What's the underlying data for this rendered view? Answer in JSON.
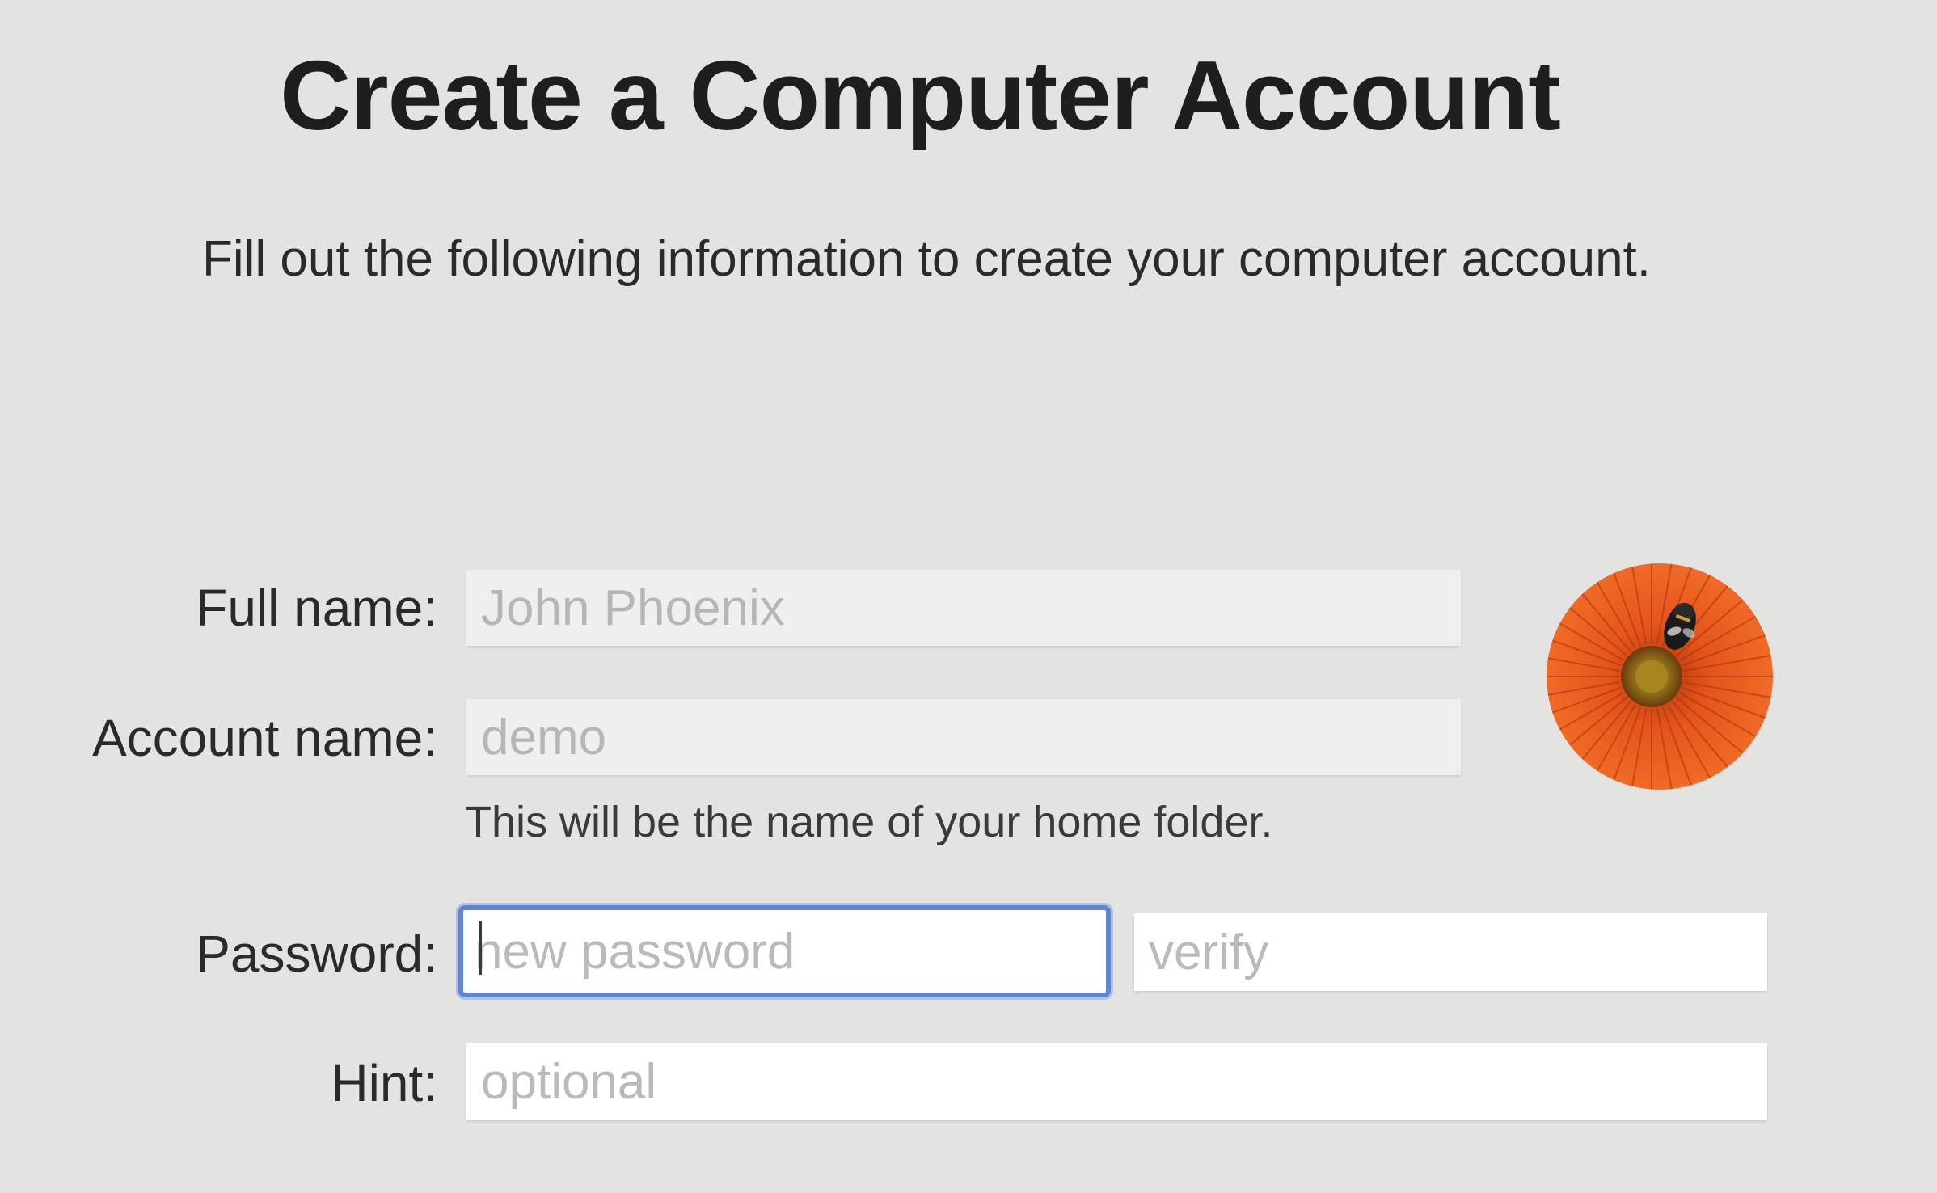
{
  "header": {
    "title": "Create a Computer Account",
    "subtitle": "Fill out the following information to create your computer account."
  },
  "form": {
    "full_name": {
      "label": "Full name:",
      "value": "John Phoenix"
    },
    "account_name": {
      "label": "Account name:",
      "value": "demo",
      "help": "This will be the name of your home folder."
    },
    "password": {
      "label": "Password:",
      "placeholder": "new password",
      "verify_placeholder": "verify"
    },
    "hint": {
      "label": "Hint:",
      "placeholder": "optional"
    }
  },
  "avatar": {
    "icon": "orange-flower-with-bee-icon"
  },
  "colors": {
    "background": "#e3e4e2",
    "focus_ring": "#5f86d6",
    "flower_orange": "#e0521a"
  }
}
